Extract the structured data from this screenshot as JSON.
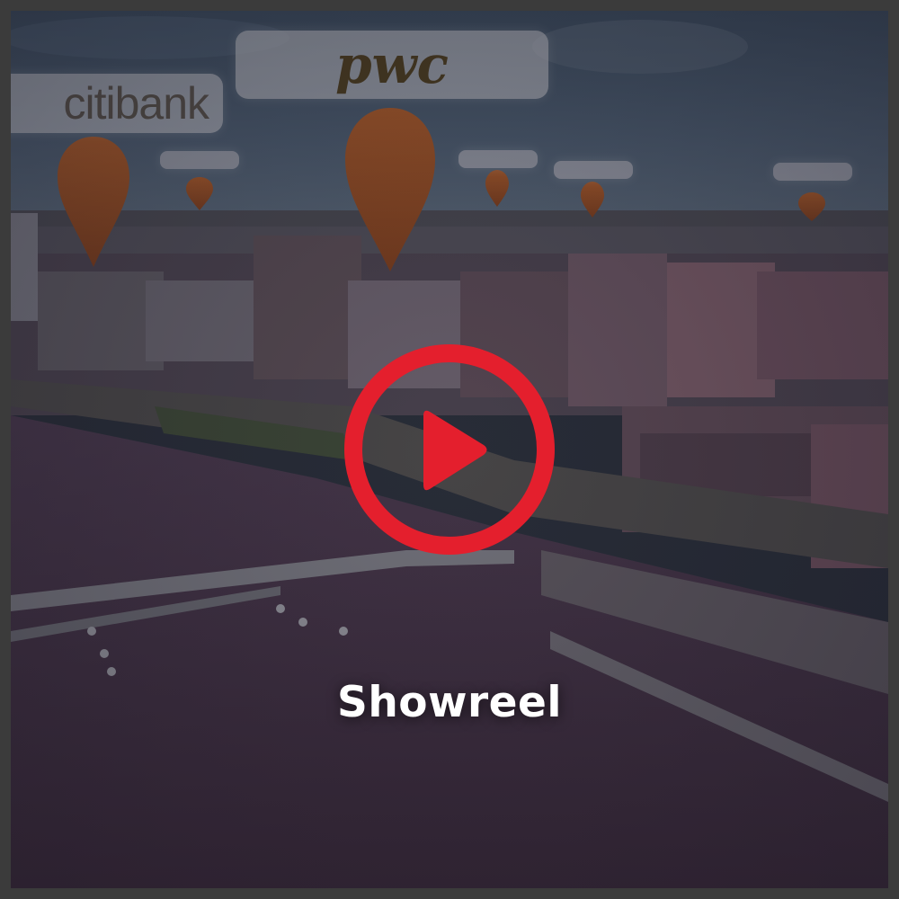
{
  "video": {
    "caption": "Showreel",
    "accent_color": "#e41f2d"
  },
  "logos": {
    "citi": "citibank",
    "pwc": "pwc"
  },
  "icons": {
    "play": "play-circle-icon",
    "pin": "map-pin-icon"
  }
}
